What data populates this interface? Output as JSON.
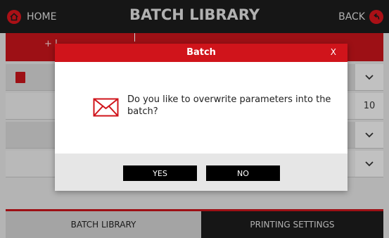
{
  "header": {
    "home_label": "HOME",
    "title": "BATCH LIBRARY",
    "back_label": "BACK"
  },
  "toolbar": {
    "add_label": "+ I"
  },
  "rows": [
    {
      "value": ""
    },
    {
      "value": "10"
    },
    {
      "value": ""
    },
    {
      "value": ""
    }
  ],
  "tabs": {
    "left": "BATCH LIBRARY",
    "right": "PRINTING SETTINGS"
  },
  "dialog": {
    "title": "Batch",
    "close": "X",
    "message": "Do you like to overwrite parameters into the batch?",
    "yes": "YES",
    "no": "NO"
  },
  "colors": {
    "brand_red": "#d0141b",
    "dark": "#1c1c1c"
  },
  "icons": [
    "home-icon",
    "back-icon",
    "document-icon",
    "chevron-down-icon",
    "envelope-icon"
  ]
}
